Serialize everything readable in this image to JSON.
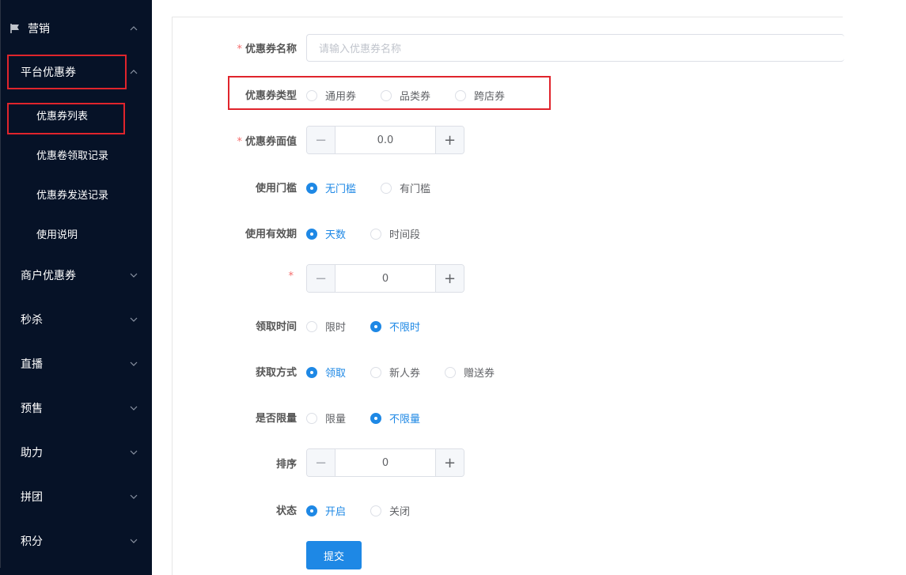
{
  "sidebar": {
    "section_marketing": "营销",
    "platform_coupon": "平台优惠券",
    "sub_items": [
      "优惠券列表",
      "优惠卷领取记录",
      "优惠券发送记录",
      "使用说明"
    ],
    "menus": [
      "商户优惠券",
      "秒杀",
      "直播",
      "预售",
      "助力",
      "拼团",
      "积分"
    ]
  },
  "form": {
    "name_label": "优惠券名称",
    "name_placeholder": "请输入优惠券名称",
    "type_label": "优惠券类型",
    "type_options": [
      "通用券",
      "品类券",
      "跨店券"
    ],
    "value_label": "优惠券面值",
    "value": "0.0",
    "threshold_label": "使用门槛",
    "threshold_options": [
      "无门槛",
      "有门槛"
    ],
    "validity_label": "使用有效期",
    "validity_options": [
      "天数",
      "时间段"
    ],
    "days_value": "0",
    "claim_time_label": "领取时间",
    "claim_time_options": [
      "限时",
      "不限时"
    ],
    "acquire_label": "获取方式",
    "acquire_options": [
      "领取",
      "新人券",
      "赠送券"
    ],
    "limit_label": "是否限量",
    "limit_options": [
      "限量",
      "不限量"
    ],
    "sort_label": "排序",
    "sort_value": "0",
    "status_label": "状态",
    "status_options": [
      "开启",
      "关闭"
    ],
    "submit_label": "提交",
    "required_mark": "*"
  },
  "colors": {
    "sidebar_bg": "#061227",
    "primary": "#1e88e5",
    "highlight": "#e0242c",
    "required": "#f56c6c"
  }
}
